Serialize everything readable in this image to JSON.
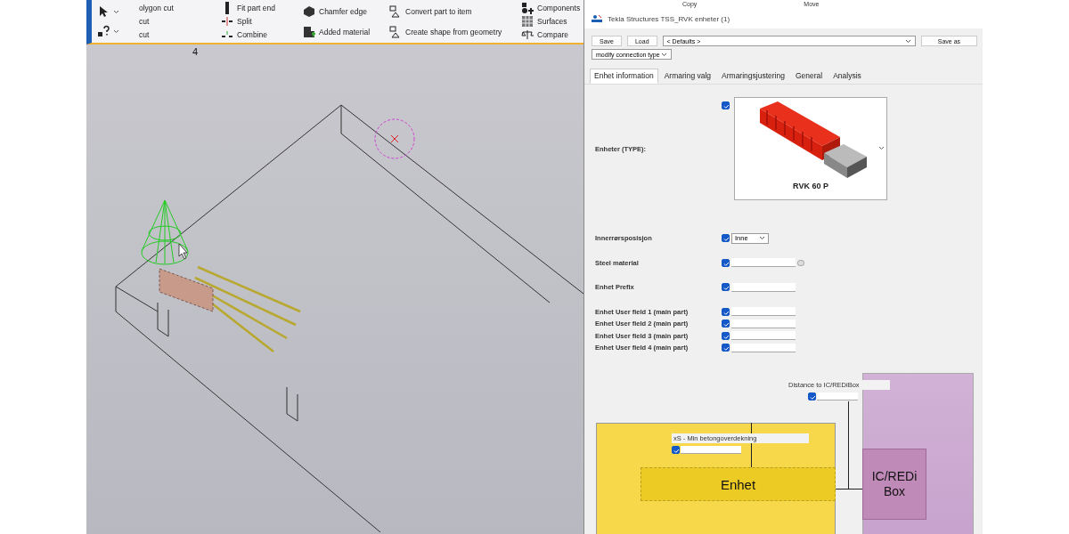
{
  "ribbon": {
    "columns": [
      {
        "items": [
          "olygon cut",
          "cut",
          "cut"
        ]
      },
      {
        "items": [
          "Fit part end",
          "Split",
          "Combine"
        ]
      },
      {
        "items": [
          "Chamfer edge",
          "Added material"
        ]
      },
      {
        "items": [
          "Convert part to item",
          "Create shape from geometry"
        ]
      },
      {
        "items": [
          "Components",
          "Surfaces",
          "Compare"
        ]
      }
    ],
    "behind_dialog": [
      "Copy",
      "Move"
    ]
  },
  "viewport": {
    "label": "4"
  },
  "dialog": {
    "title": "Tekla Structures  TSS_RVK enheter (1)",
    "toolbar": {
      "save": "Save",
      "load": "Load",
      "preset": "< Defaults >",
      "save_as": "Save as",
      "connection_type": "modify connection type"
    },
    "tabs": [
      {
        "label": "Enhet information",
        "selected": true
      },
      {
        "label": "Armaring valg",
        "selected": false
      },
      {
        "label": "Armaringsjustering",
        "selected": false
      },
      {
        "label": "General",
        "selected": false
      },
      {
        "label": "Analysis",
        "selected": false
      }
    ],
    "type_field": {
      "label": "Enheter (TYPE):",
      "checked": true,
      "caption": "RVK 60 P"
    },
    "rows": [
      {
        "label": "Innerrørsposisjon",
        "kind": "select",
        "checked": true,
        "value": "Inne"
      },
      {
        "label": "Steel material",
        "kind": "browse",
        "checked": true,
        "value": ""
      },
      {
        "label": "Enhet Prefix",
        "kind": "input",
        "checked": true,
        "value": ""
      },
      {
        "label": "Enhet User field 1 (main part)",
        "kind": "input",
        "checked": true,
        "value": ""
      },
      {
        "label": "Enhet User field 2 (main part)",
        "kind": "input",
        "checked": true,
        "value": ""
      },
      {
        "label": "Enhet User field 3 (main part)",
        "kind": "input",
        "checked": true,
        "value": ""
      },
      {
        "label": "Enhet User field 4 (main part)",
        "kind": "input",
        "checked": true,
        "value": ""
      }
    ],
    "diagram": {
      "distance": {
        "label": "Distance to IC/REDiBox",
        "checked": true
      },
      "cover": {
        "label": "xS - Min betongoverdekning",
        "checked": true
      },
      "unit_label": "Enhet",
      "box_label": "IC/REDi Box"
    }
  }
}
